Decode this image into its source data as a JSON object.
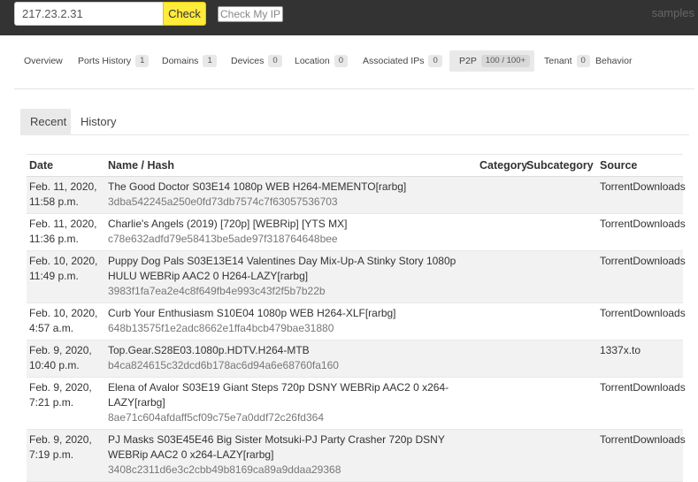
{
  "header": {
    "ip_value": "217.23.2.31",
    "check_label": "Check",
    "my_ip_label": "Check My IP",
    "samples_label": "samples"
  },
  "tabs": [
    {
      "label": "Overview",
      "badge": ""
    },
    {
      "label": "Ports History",
      "badge": "1"
    },
    {
      "label": "Domains",
      "badge": "1"
    },
    {
      "label": "Devices",
      "badge": "0"
    },
    {
      "label": "Location",
      "badge": "0"
    },
    {
      "label": "Associated IPs",
      "badge": "0"
    },
    {
      "label": "P2P",
      "badge": "100 / 100+"
    },
    {
      "label": "Tenant",
      "badge": "0"
    },
    {
      "label": "Behavior",
      "badge": ""
    }
  ],
  "subtabs": {
    "recent": "Recent",
    "history": "History"
  },
  "table": {
    "headers": {
      "date": "Date",
      "name": "Name / Hash",
      "category": "Category",
      "subcategory": "Subcategory",
      "source": "Source"
    },
    "rows": [
      {
        "date": "Feb. 11, 2020,",
        "time": "11:58 p.m.",
        "name": "The Good Doctor S03E14 1080p WEB H264-MEMENTO[rarbg]",
        "hash": "3dba542245a250e0fd73db7574c7f63057536703",
        "category": "",
        "subcategory": "",
        "source": "TorrentDownloads"
      },
      {
        "date": "Feb. 11, 2020,",
        "time": "11:36 p.m.",
        "name": "Charlie's Angels (2019) [720p] [WEBRip] [YTS MX]",
        "hash": "c78e632adfd79e58413be5ade97f318764648bee",
        "category": "",
        "subcategory": "",
        "source": "TorrentDownloads"
      },
      {
        "date": "Feb. 10, 2020,",
        "time": "11:49 p.m.",
        "name": "Puppy Dog Pals S03E13E14 Valentines Day Mix-Up-A Stinky Story 1080p HULU WEBRip AAC2 0 H264-LAZY[rarbg]",
        "hash": "3983f1fa7ea2e4c8f649fb4e993c43f2f5b7b22b",
        "category": "",
        "subcategory": "",
        "source": "TorrentDownloads"
      },
      {
        "date": "Feb. 10, 2020,",
        "time": "4:57 a.m.",
        "name": "Curb Your Enthusiasm S10E04 1080p WEB H264-XLF[rarbg]",
        "hash": "648b13575f1e2adc8662e1ffa4bcb479bae31880",
        "category": "",
        "subcategory": "",
        "source": "TorrentDownloads"
      },
      {
        "date": "Feb. 9, 2020,",
        "time": "10:40 p.m.",
        "name": "Top.Gear.S28E03.1080p.HDTV.H264-MTB",
        "hash": "b4ca824615c32dcd6b178ac6d94a6e68760fa160",
        "category": "",
        "subcategory": "",
        "source": "1337x.to"
      },
      {
        "date": "Feb. 9, 2020,",
        "time": "7:21 p.m.",
        "name": "Elena of Avalor S03E19 Giant Steps 720p DSNY WEBRip AAC2 0 x264-LAZY[rarbg]",
        "hash": "8ae71c604afdaff5cf09c75e7a0ddf72c26fd364",
        "category": "",
        "subcategory": "",
        "source": "TorrentDownloads"
      },
      {
        "date": "Feb. 9, 2020,",
        "time": "7:19 p.m.",
        "name": "PJ Masks S03E45E46 Big Sister Motsuki-PJ Party Crasher 720p DSNY WEBRip AAC2 0 x264-LAZY[rarbg]",
        "hash": "3408c2311d6e3c2cbb49b8169ca89a9ddaa29368",
        "category": "",
        "subcategory": "",
        "source": "TorrentDownloads"
      }
    ]
  }
}
